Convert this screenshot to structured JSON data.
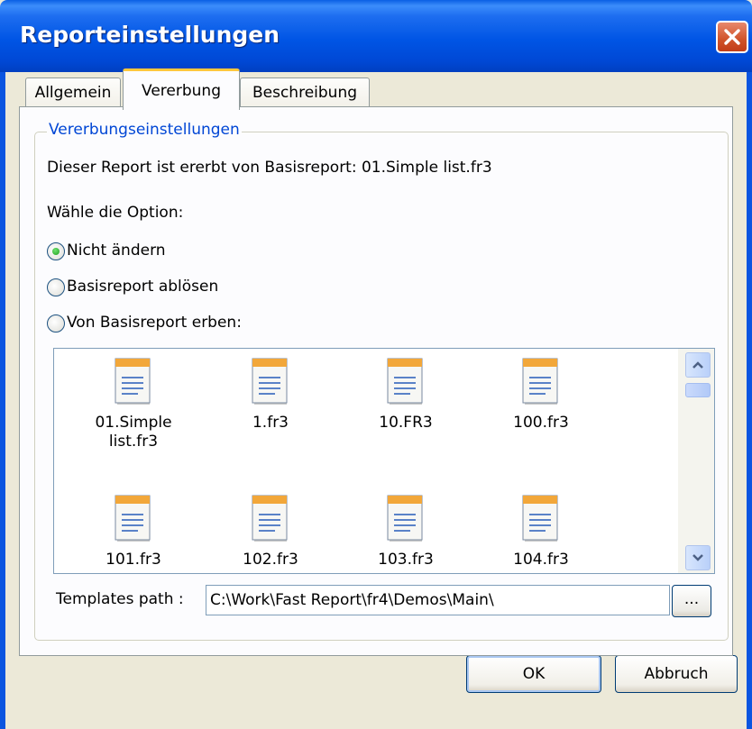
{
  "window": {
    "title": "Reporteinstellungen"
  },
  "tabs": [
    {
      "label": "Allgemein",
      "active": false
    },
    {
      "label": "Vererbung",
      "active": true
    },
    {
      "label": "Beschreibung",
      "active": false
    }
  ],
  "inheritance": {
    "group_title": "Vererbungseinstellungen",
    "info": "Dieser Report ist ererbt von Basisreport: 01.Simple list.fr3",
    "choose_label": "Wähle die Option:",
    "options": [
      {
        "label": "Nicht ändern",
        "selected": true
      },
      {
        "label": "Basisreport ablösen",
        "selected": false
      },
      {
        "label": "Von Basisreport erben:",
        "selected": false
      }
    ]
  },
  "files": [
    {
      "name": "01.Simple list.fr3",
      "icon": "report-file-icon"
    },
    {
      "name": "1.fr3",
      "icon": "report-file-icon"
    },
    {
      "name": "10.FR3",
      "icon": "report-file-icon"
    },
    {
      "name": "100.fr3",
      "icon": "report-file-icon"
    },
    {
      "name": "101.fr3",
      "icon": "report-file-icon"
    },
    {
      "name": "102.fr3",
      "icon": "report-file-icon"
    },
    {
      "name": "103.fr3",
      "icon": "report-file-icon"
    },
    {
      "name": "104.fr3",
      "icon": "report-file-icon"
    }
  ],
  "templates": {
    "label": "Templates path :",
    "path": "C:\\Work\\Fast Report\\fr4\\Demos\\Main\\",
    "browse_label": "..."
  },
  "buttons": {
    "ok": "OK",
    "cancel": "Abbruch"
  },
  "colors": {
    "titlebar": "#0055e5",
    "legend": "#0046d5",
    "active_tab_accent": "#ffc73c",
    "radio_selected": "#21a121"
  }
}
